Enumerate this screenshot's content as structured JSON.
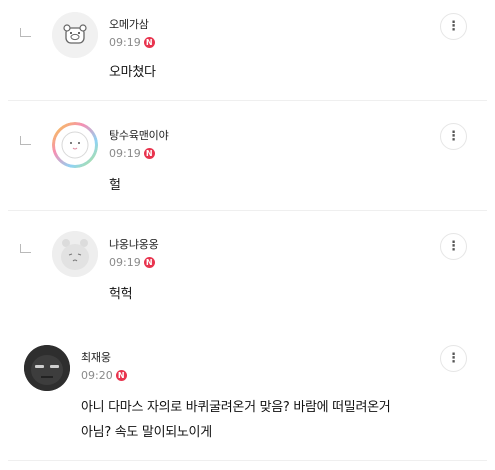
{
  "comments": [
    {
      "nickname": "오메가삼",
      "time": "09:19",
      "badge": "N",
      "text": "오마쳤다",
      "is_reply": true,
      "avatar_icon": "pig-character-avatar"
    },
    {
      "nickname": "탕수육맨이야",
      "time": "09:19",
      "badge": "N",
      "text": "헐",
      "is_reply": true,
      "avatar_icon": "rainbow-ring-cat-avatar"
    },
    {
      "nickname": "냐옹냐옹옹",
      "time": "09:19",
      "badge": "N",
      "text": "헉헉",
      "is_reply": true,
      "avatar_icon": "sad-hamster-avatar"
    },
    {
      "nickname": "최재웅",
      "time": "09:20",
      "badge": "N",
      "text_lines": [
        "아니 다마스 자의로 바퀴굴려온거 맞음? 바람에 떠밀려온거",
        "아님? 속도 말이되노이게"
      ],
      "is_reply": false,
      "avatar_icon": "dark-face-avatar"
    }
  ],
  "more_icon": "kebab-menu-icon",
  "more_glyph": "⋮",
  "colors": {
    "badge": "#e8344e",
    "meta_text": "#8a8a8a",
    "divider": "#efefef"
  }
}
